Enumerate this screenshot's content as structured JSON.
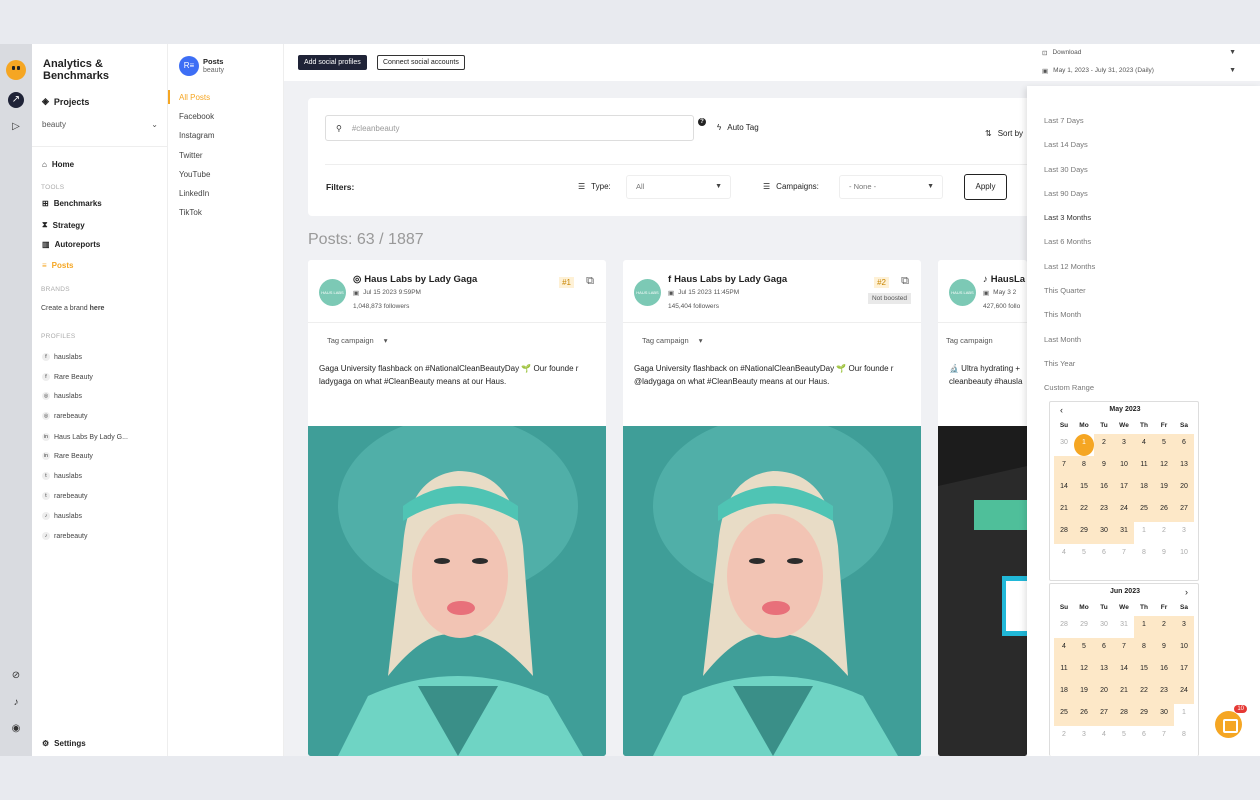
{
  "app": {
    "title": "Analytics & Benchmarks"
  },
  "nav": {
    "projects": "Projects",
    "project_selected": "beauty",
    "home": "Home",
    "tools_header": "TOOLS",
    "tools": [
      "Benchmarks",
      "Strategy",
      "Autoreports",
      "Posts"
    ],
    "brands_header": "BRANDS",
    "brand_prompt": "Create a brand ",
    "brand_link": "here",
    "profiles_header": "PROFILES",
    "profiles": [
      {
        "icon": "f",
        "name": "hauslabs"
      },
      {
        "icon": "f",
        "name": "Rare Beauty"
      },
      {
        "icon": "◎",
        "name": "hauslabs"
      },
      {
        "icon": "◎",
        "name": "rarebeauty"
      },
      {
        "icon": "in",
        "name": "Haus Labs By Lady G..."
      },
      {
        "icon": "in",
        "name": "Rare Beauty"
      },
      {
        "icon": "t",
        "name": "hauslabs"
      },
      {
        "icon": "t",
        "name": "rarebeauty"
      },
      {
        "icon": "♪",
        "name": "hauslabs"
      },
      {
        "icon": "♪",
        "name": "rarebeauty"
      }
    ],
    "settings": "Settings"
  },
  "subnav": {
    "title": "Posts",
    "subtitle": "beauty",
    "items": [
      "All Posts",
      "Facebook",
      "Instagram",
      "Twitter",
      "YouTube",
      "LinkedIn",
      "TikTok"
    ]
  },
  "topbar": {
    "add_profiles": "Add social profiles",
    "connect_accounts": "Connect social accounts",
    "download": "Download",
    "date_range": "May 1, 2023 - July 31, 2023 (Daily)"
  },
  "filters": {
    "search_placeholder": "#cleanbeauty",
    "auto_tag": "Auto Tag",
    "sort_by": "Sort by",
    "label": "Filters:",
    "type_label": "Type:",
    "type_value": "All",
    "campaigns_label": "Campaigns:",
    "campaigns_value": "- None -",
    "apply": "Apply"
  },
  "posts_count": "Posts: 63 / 1887",
  "posts": [
    {
      "avatar": "HAUS LABS BY LADY GAGA",
      "platform_icon": "◎",
      "name": "Haus Labs by Lady Gaga",
      "date": "Jul 15 2023 9:59PM",
      "followers": "1,048,873 followers",
      "rank": "#1",
      "boosted": "",
      "tag": "Tag campaign",
      "caption": "Gaga University flashback on #NationalCleanBeautyDay 🌱 Our founde r ladygaga on what #CleanBeauty means at our Haus."
    },
    {
      "avatar": "HAUS LABS BY LADY GAGA",
      "platform_icon": "f",
      "name": "Haus Labs by Lady Gaga",
      "date": "Jul 15 2023 11:45PM",
      "followers": "145,404 followers",
      "rank": "#2",
      "boosted": "Not boosted",
      "tag": "Tag campaign",
      "caption": "Gaga University flashback on #NationalCleanBeautyDay 🌱 Our founde r @ladygaga on what #CleanBeauty means at our Haus."
    },
    {
      "avatar": "HAUS LABS BY LADY GAGA",
      "platform_icon": "♪",
      "name": "HausLa",
      "date": "May 3 2",
      "followers": "427,600 follo",
      "rank": "",
      "boosted": "",
      "tag": "Tag campaign",
      "caption": "🔬 Ultra hydrating + cleanbeauty #hausla"
    }
  ],
  "date_options": [
    "Last 7 Days",
    "Last 14 Days",
    "Last 30 Days",
    "Last 90 Days",
    "Last 3 Months",
    "Last 6 Months",
    "Last 12 Months",
    "This Quarter",
    "This Month",
    "Last Month",
    "This Year",
    "Custom Range"
  ],
  "calendar": {
    "weekdays": [
      "Su",
      "Mo",
      "Tu",
      "We",
      "Th",
      "Fr",
      "Sa"
    ],
    "months": [
      {
        "title": "May 2023",
        "days": [
          "30",
          "1",
          "2",
          "3",
          "4",
          "5",
          "6",
          "7",
          "8",
          "9",
          "10",
          "11",
          "12",
          "13",
          "14",
          "15",
          "16",
          "17",
          "18",
          "19",
          "20",
          "21",
          "22",
          "23",
          "24",
          "25",
          "26",
          "27",
          "28",
          "29",
          "30",
          "31",
          "1",
          "2",
          "3",
          "4",
          "5",
          "6",
          "7",
          "8",
          "9",
          "10"
        ]
      },
      {
        "title": "Jun 2023",
        "days": [
          "28",
          "29",
          "30",
          "31",
          "1",
          "2",
          "3",
          "4",
          "5",
          "6",
          "7",
          "8",
          "9",
          "10",
          "11",
          "12",
          "13",
          "14",
          "15",
          "16",
          "17",
          "18",
          "19",
          "20",
          "21",
          "22",
          "23",
          "24",
          "25",
          "26",
          "27",
          "28",
          "29",
          "30",
          "1",
          "2",
          "3",
          "4",
          "5",
          "6",
          "7",
          "8"
        ]
      }
    ]
  },
  "chat_badge": "10",
  "colors": {
    "accent": "#f5a623",
    "range": "#fde8c8",
    "dark": "#1f2337"
  }
}
